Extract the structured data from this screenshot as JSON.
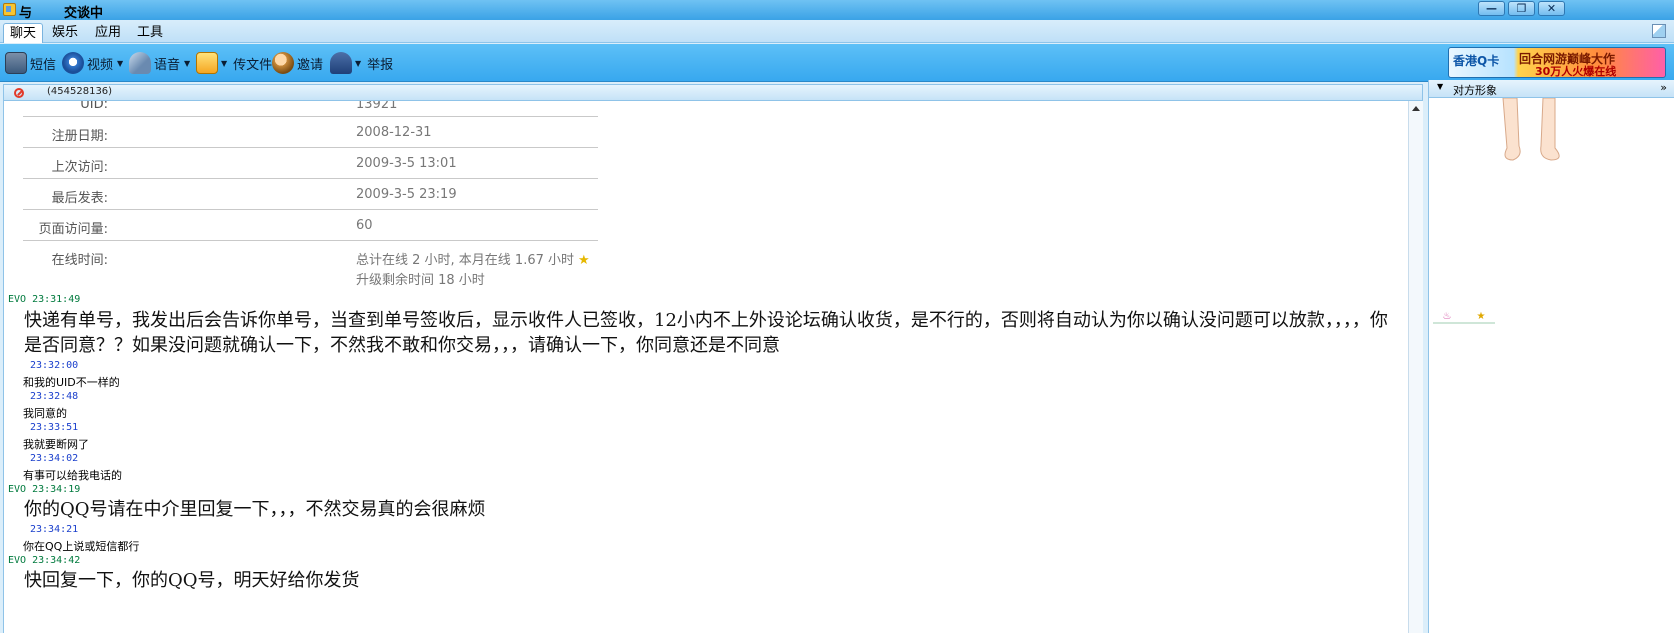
{
  "window": {
    "title_left": "与",
    "title_status": "交谈中",
    "buttons": {
      "minimize": "—",
      "restore": "❐",
      "close": "✕"
    }
  },
  "menu": {
    "tabs": [
      "聊天",
      "娱乐",
      "应用",
      "工具"
    ]
  },
  "toolbar": {
    "sms": "短信",
    "video": "视频",
    "voice": "语音",
    "send_file": "传文件",
    "invite": "邀请",
    "report": "举报",
    "banner_logo": "香港Q卡",
    "banner_line1": "回合网游巅峰大作",
    "banner_line2": "30万人火爆在线"
  },
  "chat_header": {
    "uin": "(454528136)"
  },
  "profile": {
    "rows": [
      {
        "label": "UID:",
        "value": "13921"
      },
      {
        "label": "注册日期:",
        "value": "2008-12-31"
      },
      {
        "label": "上次访问:",
        "value": "2009-3-5 13:01"
      },
      {
        "label": "最后发表:",
        "value": "2009-3-5 23:19"
      },
      {
        "label": "页面访问量:",
        "value": "60"
      },
      {
        "label": "在线时间:",
        "value": "总计在线 2 小时, 本月在线 1.67 小时",
        "value2": "升级剩余时间 18 小时"
      }
    ]
  },
  "messages": [
    {
      "sender": "EVO",
      "time": "EVO 23:31:49",
      "text": "快递有单号，我发出后会告诉你单号，当查到单号签收后，显示收件人已签收，12小内不上外设论坛确认收货，是不行的，否则将自动认为你以确认没问题可以放款，，，，你是否同意？？如果没问题就确认一下，不然我不敢和你交易，，，请确认一下，你同意还是不同意"
    },
    {
      "sender": "me",
      "time": "23:32:00",
      "text": "和我的UID不一样的"
    },
    {
      "sender": "me",
      "time": "23:32:48",
      "text": "我同意的"
    },
    {
      "sender": "me",
      "time": "23:33:51",
      "text": "我就要断网了"
    },
    {
      "sender": "me",
      "time": "23:34:02",
      "text": "有事可以给我电话的"
    },
    {
      "sender": "EVO",
      "time": "EVO 23:34:19",
      "text": "你的QQ号请在中介里回复一下，，，不然交易真的会很麻烦"
    },
    {
      "sender": "me",
      "time": "23:34:21",
      "text": "你在QQ上说或短信都行"
    },
    {
      "sender": "EVO",
      "time": "EVO 23:34:42",
      "text": "快回复一下，你的QQ号，明天好给你发货"
    }
  ],
  "side_panel": {
    "title": "对方形象",
    "more": "»"
  }
}
